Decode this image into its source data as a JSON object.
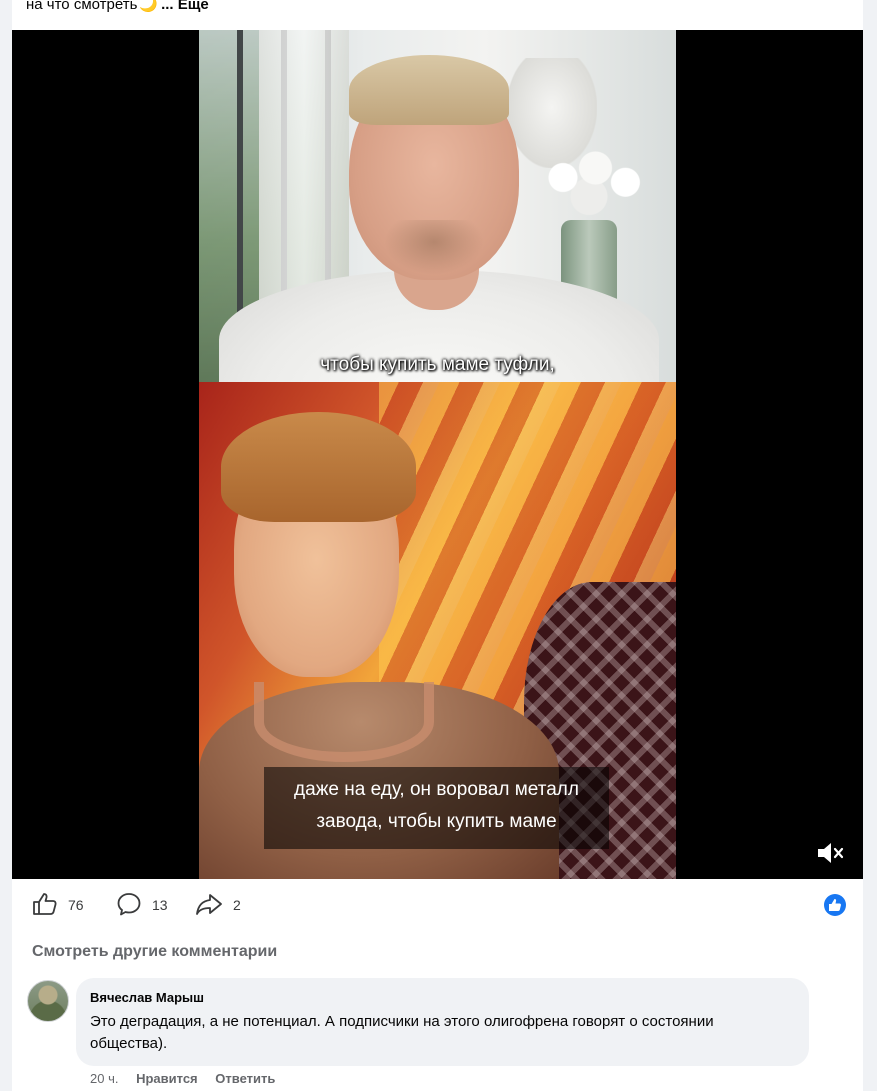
{
  "post": {
    "text_tail": "на что смотреть",
    "emoji": "🌙",
    "more_label": "... Еще"
  },
  "video": {
    "subtitle_top": "чтобы купить маме туфли,",
    "subtitle_bottom_line1": "даже на еду, он воровал металл",
    "subtitle_bottom_line2": "завода, чтобы купить маме",
    "mute_icon": "speaker-muted-icon"
  },
  "actions": {
    "likes": "76",
    "comments": "13",
    "shares": "2",
    "like_icon": "thumbs-up-icon",
    "comment_icon": "comment-bubble-icon",
    "share_icon": "share-arrow-icon",
    "reaction_icon": "like-reaction-icon",
    "accent_color": "#1877f2"
  },
  "comments": {
    "more_label": "Смотреть другие комментарии",
    "items": [
      {
        "author": "Вячеслав Марыш",
        "text": "Это деградация, а не потенциал. А подписчики на этого олигофрена говорят о состоянии общества).",
        "time": "20 ч.",
        "like_label": "Нравится",
        "reply_label": "Ответить"
      }
    ]
  }
}
